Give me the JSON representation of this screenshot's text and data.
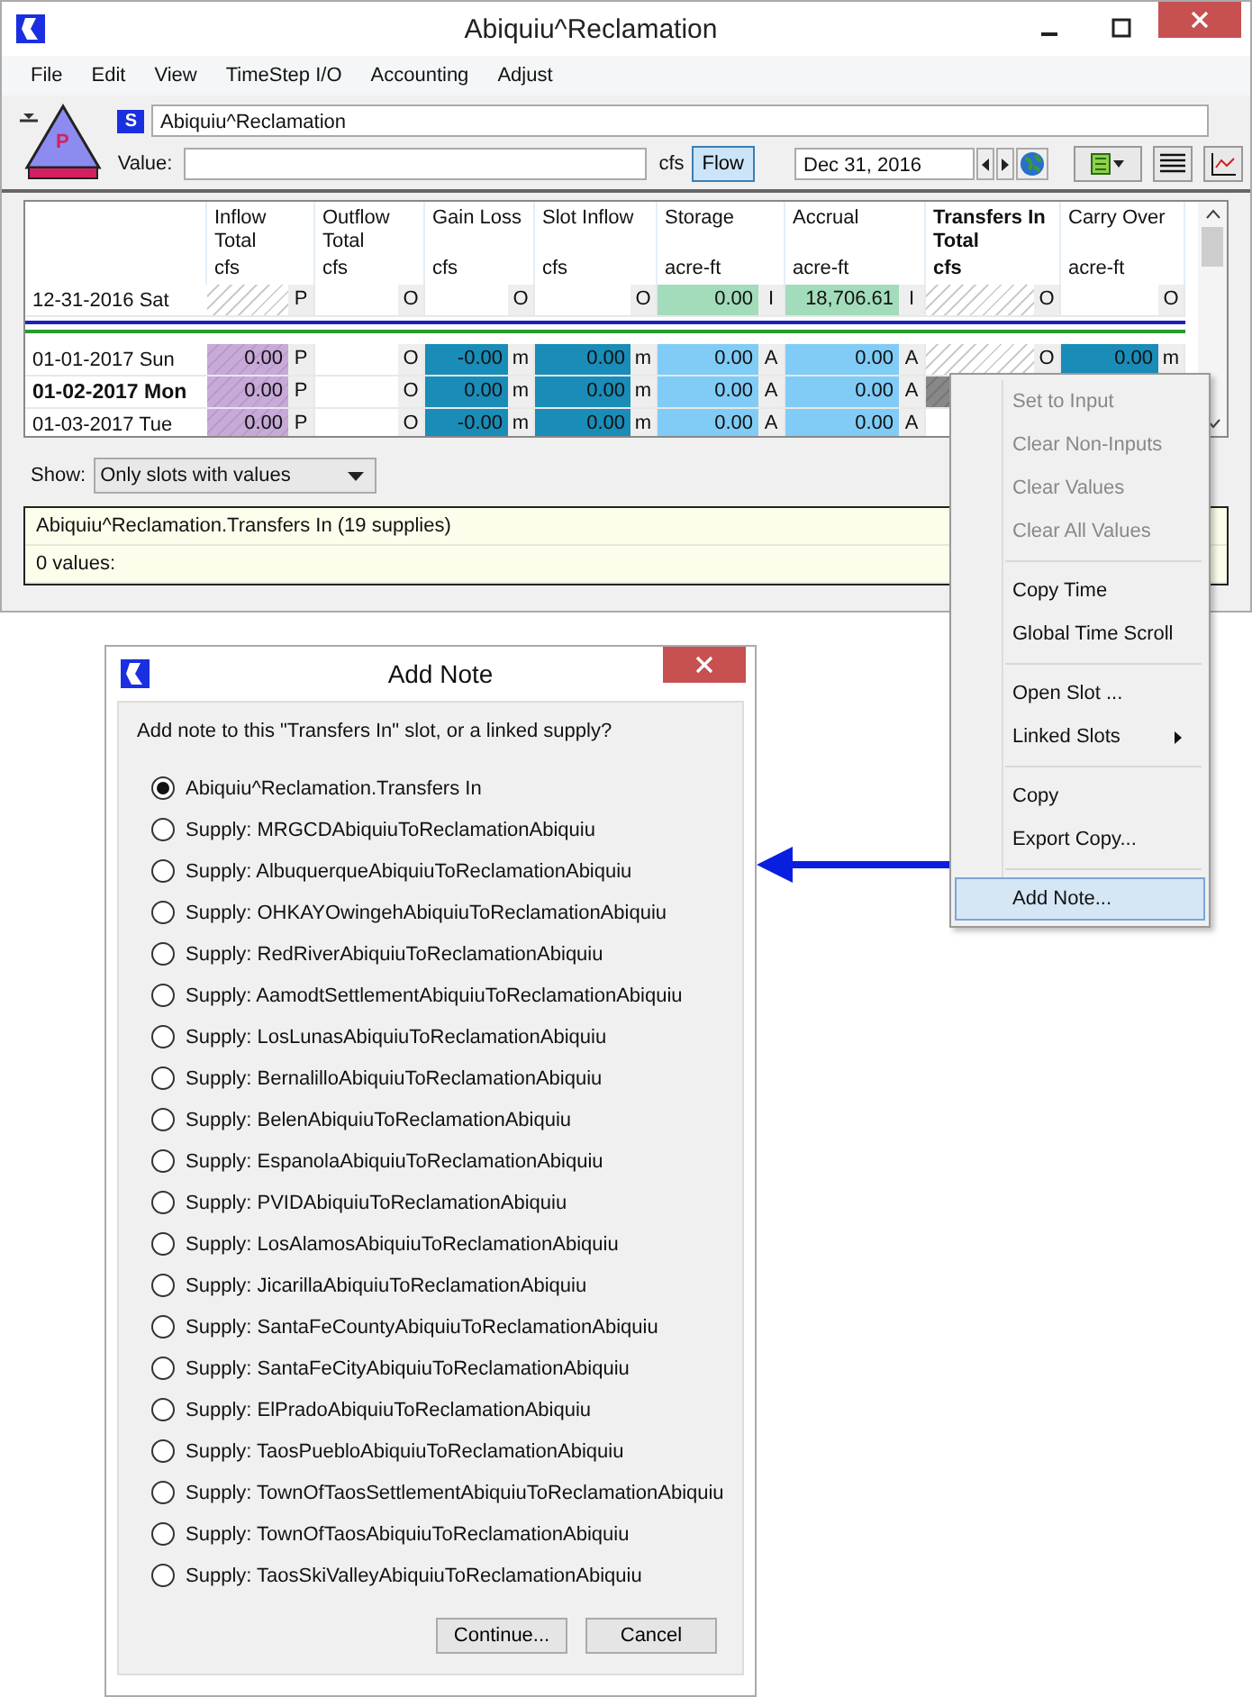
{
  "window": {
    "title": "Abiquiu^Reclamation"
  },
  "menu": [
    "File",
    "Edit",
    "View",
    "TimeStep I/O",
    "Accounting",
    "Adjust"
  ],
  "object": {
    "icon_letter": "P",
    "slot_badge": "S",
    "slot_name": "Abiquiu^Reclamation",
    "value_label": "Value:",
    "unit": "cfs",
    "flow_button": {
      "label": "Flow",
      "on": true
    },
    "date": "Dec 31, 2016"
  },
  "table": {
    "columns": [
      {
        "title": "Inflow\nTotal",
        "unit": "cfs",
        "selected": false
      },
      {
        "title": "Outflow\nTotal",
        "unit": "cfs",
        "selected": false
      },
      {
        "title": "Gain Loss",
        "unit": "cfs",
        "selected": false
      },
      {
        "title": "Slot Inflow",
        "unit": "cfs",
        "selected": false
      },
      {
        "title": "Storage",
        "unit": "acre-ft",
        "selected": false
      },
      {
        "title": "Accrual",
        "unit": "acre-ft",
        "selected": false
      },
      {
        "title": "Transfers In\nTotal",
        "unit": "cfs",
        "selected": true
      },
      {
        "title": "Carry Over",
        "unit": "acre-ft",
        "selected": false
      }
    ],
    "initial_row": {
      "date": "12-31-2016 Sat",
      "selected": false,
      "cells": [
        {
          "kind": "hatch",
          "flag": "P"
        },
        {
          "kind": "plain",
          "flag": "O"
        },
        {
          "kind": "plain",
          "flag": "O"
        },
        {
          "kind": "plain",
          "flag": "O"
        },
        {
          "kind": "green",
          "value": "0.00",
          "flag": "I"
        },
        {
          "kind": "green",
          "value": "18,706.61",
          "flag": "I"
        },
        {
          "kind": "hatch",
          "flag": "O"
        },
        {
          "kind": "plain",
          "flag": "O"
        }
      ]
    },
    "rows": [
      {
        "date": "01-01-2017 Sun",
        "selected": false,
        "cells": [
          {
            "kind": "purple",
            "value": "0.00",
            "flag": "P"
          },
          {
            "kind": "plain",
            "flag": "O"
          },
          {
            "kind": "teal",
            "value": "-0.00",
            "flag": "m"
          },
          {
            "kind": "teal",
            "value": "0.00",
            "flag": "m"
          },
          {
            "kind": "light",
            "value": "0.00",
            "flag": "A"
          },
          {
            "kind": "light",
            "value": "0.00",
            "flag": "A"
          },
          {
            "kind": "hatch",
            "flag": "O"
          },
          {
            "kind": "teal",
            "value": "0.00",
            "flag": "m"
          }
        ]
      },
      {
        "date": "01-02-2017 Mon",
        "selected": true,
        "cells": [
          {
            "kind": "purple",
            "value": "0.00",
            "flag": "P"
          },
          {
            "kind": "plain",
            "flag": "O"
          },
          {
            "kind": "teal",
            "value": "0.00",
            "flag": "m"
          },
          {
            "kind": "teal",
            "value": "0.00",
            "flag": "m"
          },
          {
            "kind": "light",
            "value": "0.00",
            "flag": "A"
          },
          {
            "kind": "light",
            "value": "0.00",
            "flag": "A"
          },
          {
            "kind": "dark"
          }
        ]
      },
      {
        "date": "01-03-2017 Tue",
        "selected": false,
        "cells": [
          {
            "kind": "purple",
            "value": "0.00",
            "flag": "P"
          },
          {
            "kind": "plain",
            "flag": "O"
          },
          {
            "kind": "teal",
            "value": "-0.00",
            "flag": "m"
          },
          {
            "kind": "teal",
            "value": "0.00",
            "flag": "m"
          },
          {
            "kind": "light",
            "value": "0.00",
            "flag": "A"
          },
          {
            "kind": "light",
            "value": "0.00",
            "flag": "A"
          }
        ]
      }
    ]
  },
  "show": {
    "label": "Show:",
    "value": "Only slots with values"
  },
  "info": {
    "title": "Abiquiu^Reclamation.Transfers In (19 supplies)",
    "values": "0 values:"
  },
  "context_menu": {
    "groups": [
      [
        {
          "label": "Set to Input",
          "disabled": true,
          "selected": false,
          "submenu": false
        },
        {
          "label": "Clear Non-Inputs",
          "disabled": true,
          "selected": false,
          "submenu": false
        },
        {
          "label": "Clear Values",
          "disabled": true,
          "selected": false,
          "submenu": false
        },
        {
          "label": "Clear All Values",
          "disabled": true,
          "selected": false,
          "submenu": false
        }
      ],
      [
        {
          "label": "Copy Time",
          "disabled": false,
          "selected": false,
          "submenu": false
        },
        {
          "label": "Global Time Scroll",
          "disabled": false,
          "selected": false,
          "submenu": false
        }
      ],
      [
        {
          "label": "Open Slot ...",
          "disabled": false,
          "selected": false,
          "submenu": false
        },
        {
          "label": "Linked Slots",
          "disabled": false,
          "selected": false,
          "submenu": true
        }
      ],
      [
        {
          "label": "Copy",
          "disabled": false,
          "selected": false,
          "submenu": false
        },
        {
          "label": "Export Copy...",
          "disabled": false,
          "selected": false,
          "submenu": false
        }
      ],
      [
        {
          "label": "Add Note...",
          "disabled": false,
          "selected": true,
          "submenu": false
        }
      ]
    ]
  },
  "dialog": {
    "title": "Add Note",
    "prompt": "Add note to this \"Transfers In\" slot, or a linked supply?",
    "options": [
      {
        "label": "Abiquiu^Reclamation.Transfers In",
        "selected": true
      },
      {
        "label": "Supply: MRGCDAbiquiuToReclamationAbiquiu",
        "selected": false
      },
      {
        "label": "Supply: AlbuquerqueAbiquiuToReclamationAbiquiu",
        "selected": false
      },
      {
        "label": "Supply: OHKAYOwingehAbiquiuToReclamationAbiquiu",
        "selected": false
      },
      {
        "label": "Supply: RedRiverAbiquiuToReclamationAbiquiu",
        "selected": false
      },
      {
        "label": "Supply: AamodtSettlementAbiquiuToReclamationAbiquiu",
        "selected": false
      },
      {
        "label": "Supply: LosLunasAbiquiuToReclamationAbiquiu",
        "selected": false
      },
      {
        "label": "Supply: BernalilloAbiquiuToReclamationAbiquiu",
        "selected": false
      },
      {
        "label": "Supply: BelenAbiquiuToReclamationAbiquiu",
        "selected": false
      },
      {
        "label": "Supply: EspanolaAbiquiuToReclamationAbiquiu",
        "selected": false
      },
      {
        "label": "Supply: PVIDAbiquiuToReclamationAbiquiu",
        "selected": false
      },
      {
        "label": "Supply: LosAlamosAbiquiuToReclamationAbiquiu",
        "selected": false
      },
      {
        "label": "Supply: JicarillaAbiquiuToReclamationAbiquiu",
        "selected": false
      },
      {
        "label": "Supply: SantaFeCountyAbiquiuToReclamationAbiquiu",
        "selected": false
      },
      {
        "label": "Supply: SantaFeCityAbiquiuToReclamationAbiquiu",
        "selected": false
      },
      {
        "label": "Supply: ElPradoAbiquiuToReclamationAbiquiu",
        "selected": false
      },
      {
        "label": "Supply: TaosPuebloAbiquiuToReclamationAbiquiu",
        "selected": false
      },
      {
        "label": "Supply: TownOfTaosSettlementAbiquiuToReclamationAbiquiu",
        "selected": false
      },
      {
        "label": "Supply: TownOfTaosAbiquiuToReclamationAbiquiu",
        "selected": false
      },
      {
        "label": "Supply: TaosSkiValleyAbiquiuToReclamationAbiquiu",
        "selected": false
      }
    ],
    "buttons": [
      "Continue...",
      "Cancel"
    ]
  }
}
